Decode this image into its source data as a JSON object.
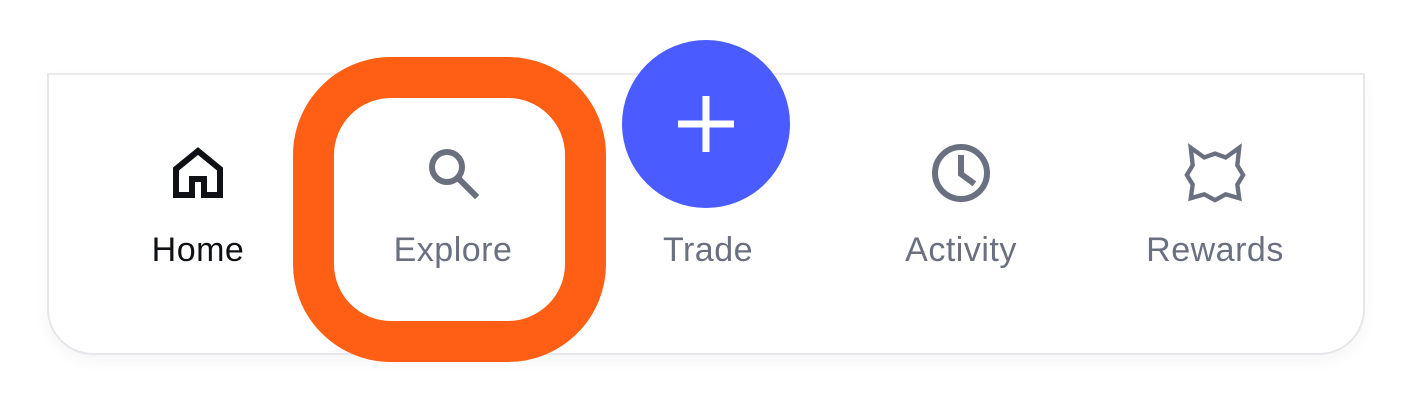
{
  "colors": {
    "highlight": "#ff5f14",
    "fab": "#4a5cff",
    "active_text": "#0f1115",
    "inactive_text": "#6b7080"
  },
  "nav": {
    "items": [
      {
        "label": "Home",
        "icon": "home-icon",
        "active": true
      },
      {
        "label": "Explore",
        "icon": "search-icon",
        "active": false
      },
      {
        "label": "Trade",
        "icon": "plus-icon",
        "active": false
      },
      {
        "label": "Activity",
        "icon": "clock-icon",
        "active": false
      },
      {
        "label": "Rewards",
        "icon": "rewards-shape-icon",
        "active": false
      }
    ]
  }
}
